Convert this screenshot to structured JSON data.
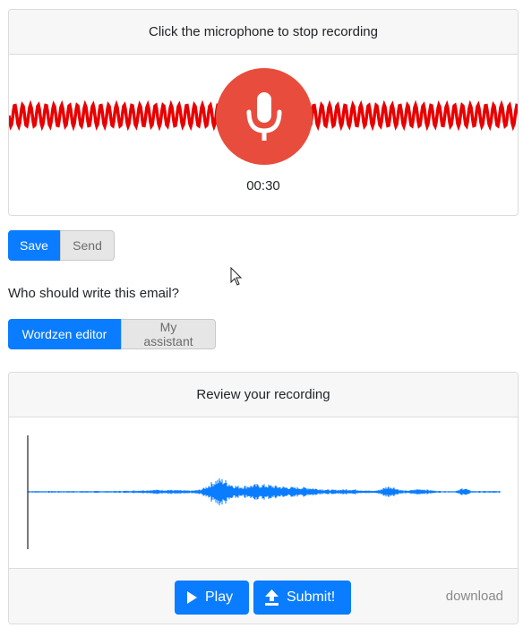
{
  "recorder": {
    "prompt": "Click the microphone to stop recording",
    "timer": "00:30",
    "mic_icon": "microphone-icon",
    "wave_color": "#e80000",
    "mic_color": "#e84c3d"
  },
  "actions": {
    "save_label": "Save",
    "send_label": "Send",
    "active": "Save"
  },
  "writer": {
    "question": "Who should write this email?",
    "options": [
      "Wordzen editor",
      "My assistant"
    ],
    "selected": "Wordzen editor"
  },
  "review": {
    "title": "Review your recording",
    "waveform_color": "#0a7cff",
    "play_label": "Play",
    "play_icon": "play-icon",
    "submit_label": "Submit!",
    "submit_icon": "upload-icon",
    "download_label": "download"
  },
  "colors": {
    "primary": "#0a7cff",
    "inactive_bg": "#e6e6e6",
    "header_bg": "#f7f7f7"
  }
}
